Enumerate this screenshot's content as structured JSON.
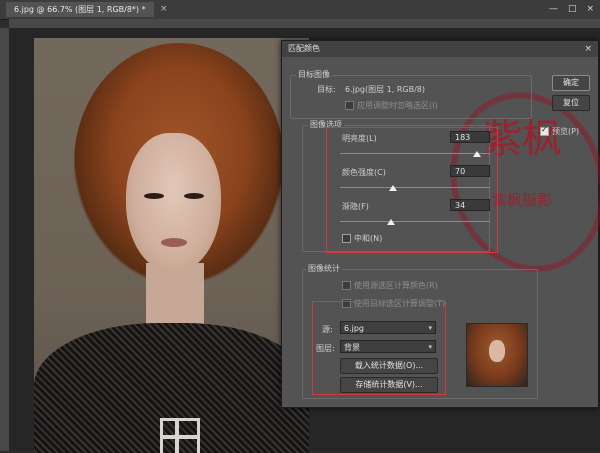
{
  "document": {
    "tab_title": "6.jpg @ 66.7% (图层 1, RGB/8*) *",
    "tab_close": "×"
  },
  "window_buttons": [
    "—",
    "□",
    "×"
  ],
  "dialog": {
    "title": "匹配颜色",
    "close": "×",
    "target_image": {
      "group_label": "目标图像",
      "target_label": "目标:",
      "target_value": "6.jpg(图层 1, RGB/8)",
      "ignore_selection_label": "应用调整时忽略选区(I)"
    },
    "image_options": {
      "group_label": "图像选项",
      "luminance": {
        "label": "明亮度(L)",
        "value": "183",
        "fraction": 0.915
      },
      "color_intensity": {
        "label": "颜色强度(C)",
        "value": "70",
        "fraction": 0.35
      },
      "fade": {
        "label": "渐隐(F)",
        "value": "34",
        "fraction": 0.34
      },
      "neutralize_label": "中和(N)"
    },
    "image_statistics": {
      "group_label": "图像统计",
      "use_selection_source": "使用源选区计算颜色(R)",
      "use_selection_target": "使用目标选区计算调整(T)",
      "source_label": "源:",
      "source_value": "6.jpg",
      "layer_label": "图层:",
      "layer_value": "背景",
      "load_button": "载入统计数据(O)...",
      "save_button": "存储统计数据(V)..."
    },
    "ok_button": "确定",
    "reset_button": "复位",
    "preview_label": "预览(P)",
    "watermark": {
      "big": "紫枫",
      "small": "紫枫摄影"
    }
  },
  "colors": {
    "highlight_box": "#d13a3a",
    "dialog_bg": "#535353"
  }
}
